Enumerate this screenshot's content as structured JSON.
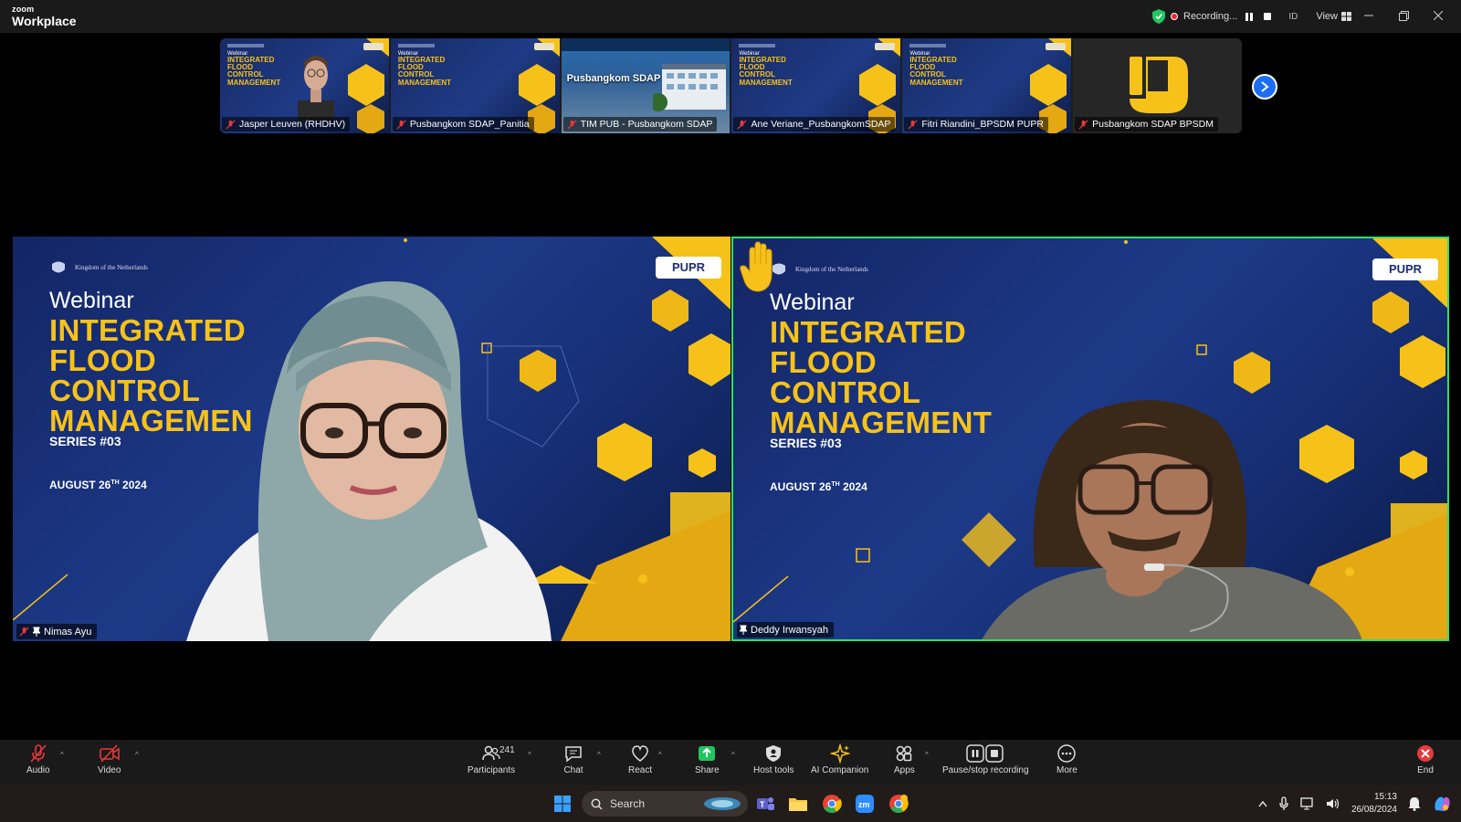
{
  "app": {
    "brand_small": "zoom",
    "brand_large": "Workplace",
    "recording_label": "Recording...",
    "id_label": "ID",
    "view_label": "View"
  },
  "thumbnails": [
    {
      "name": "Jasper Leuven (RHDHV)",
      "kind": "camera"
    },
    {
      "name": "Pusbangkom SDAP_Panitia",
      "kind": "slide"
    },
    {
      "name": "TIM PUB - Pusbangkom SDAP",
      "kind": "building"
    },
    {
      "name": "Ane Veriane_PusbangkomSDAP",
      "kind": "slide"
    },
    {
      "name": "Fitri Riandini_BPSDM PUPR",
      "kind": "slide"
    },
    {
      "name": "Pusbangkom SDAP BPSDM",
      "kind": "logo"
    }
  ],
  "thumb_slide": {
    "webinar": "Webinar",
    "title": "INTEGRATED\nFLOOD\nCONTROL\nMANAGEMENT"
  },
  "thumb_building_title": "Pusbangkom SDAP",
  "slide": {
    "kingdom": "Kingdom of the Netherlands",
    "badge": "PUPR",
    "webinar": "Webinar",
    "series": "SERIES #03",
    "date_day": "AUGUST 26",
    "date_sup": "TH",
    "date_year": "2024"
  },
  "main_tiles": [
    {
      "name": "Nimas Ayu",
      "title": "INTEGRATED\nFLOOD\nCONTROL\nMANAGEMEN",
      "hand_raised": false
    },
    {
      "name": "Deddy Irwansyah",
      "title": "INTEGRATED\nFLOOD\nCONTROL\nMANAGEMENT",
      "hand_raised": true
    }
  ],
  "toolbar": {
    "audio": "Audio",
    "video": "Video",
    "participants": "Participants",
    "participants_count": "241",
    "chat": "Chat",
    "react": "React",
    "share": "Share",
    "host_tools": "Host tools",
    "ai_companion": "AI Companion",
    "apps": "Apps",
    "pause_stop": "Pause/stop recording",
    "more": "More",
    "end": "End"
  },
  "taskbar": {
    "search": "Search",
    "time": "15:13",
    "date": "26/08/2024"
  },
  "colors": {
    "accent_green": "#2ee06b",
    "share_green": "#22c55e",
    "end_red": "#e5393b",
    "slide_gold": "#f6c21a",
    "slide_navy": "#1d3a88"
  }
}
